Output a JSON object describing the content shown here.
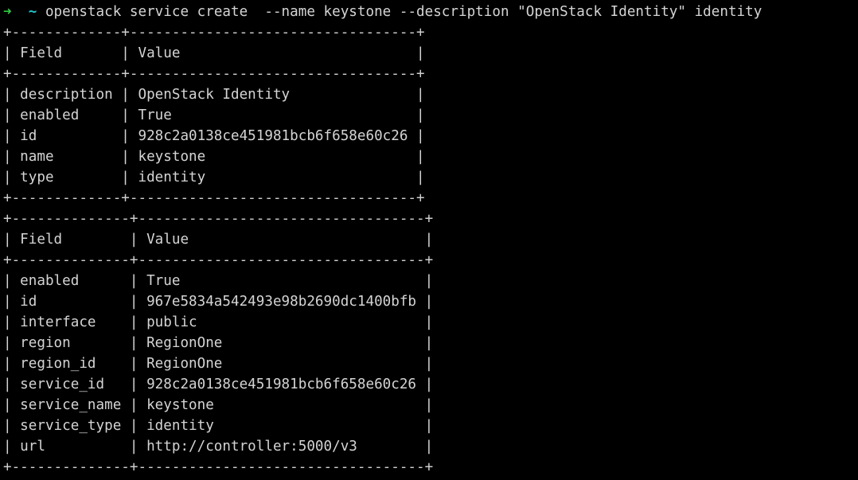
{
  "prompt": {
    "arrow": "➜",
    "cwd": "~",
    "command": "openstack service create  --name keystone --description \"OpenStack Identity\" identity"
  },
  "output_lines": [
    "+-------------+----------------------------------+",
    "| Field       | Value                            |",
    "+-------------+----------------------------------+",
    "| description | OpenStack Identity               |",
    "| enabled     | True                             |",
    "| id          | 928c2a0138ce451981bcb6f658e60c26 |",
    "| name        | keystone                         |",
    "| type        | identity                         |",
    "+-------------+----------------------------------+",
    "+--------------+----------------------------------+",
    "| Field        | Value                            |",
    "+--------------+----------------------------------+",
    "| enabled      | True                             |",
    "| id           | 967e5834a542493e98b2690dc1400bfb |",
    "| interface    | public                           |",
    "| region       | RegionOne                        |",
    "| region_id    | RegionOne                        |",
    "| service_id   | 928c2a0138ce451981bcb6f658e60c26 |",
    "| service_name | keystone                         |",
    "| service_type | identity                         |",
    "| url          | http://controller:5000/v3        |",
    "+--------------+----------------------------------+"
  ],
  "colors": {
    "background": "#000000",
    "text": "#d4d4d4",
    "prompt_arrow": "#2ecc40",
    "prompt_tilde": "#22c3c9"
  }
}
